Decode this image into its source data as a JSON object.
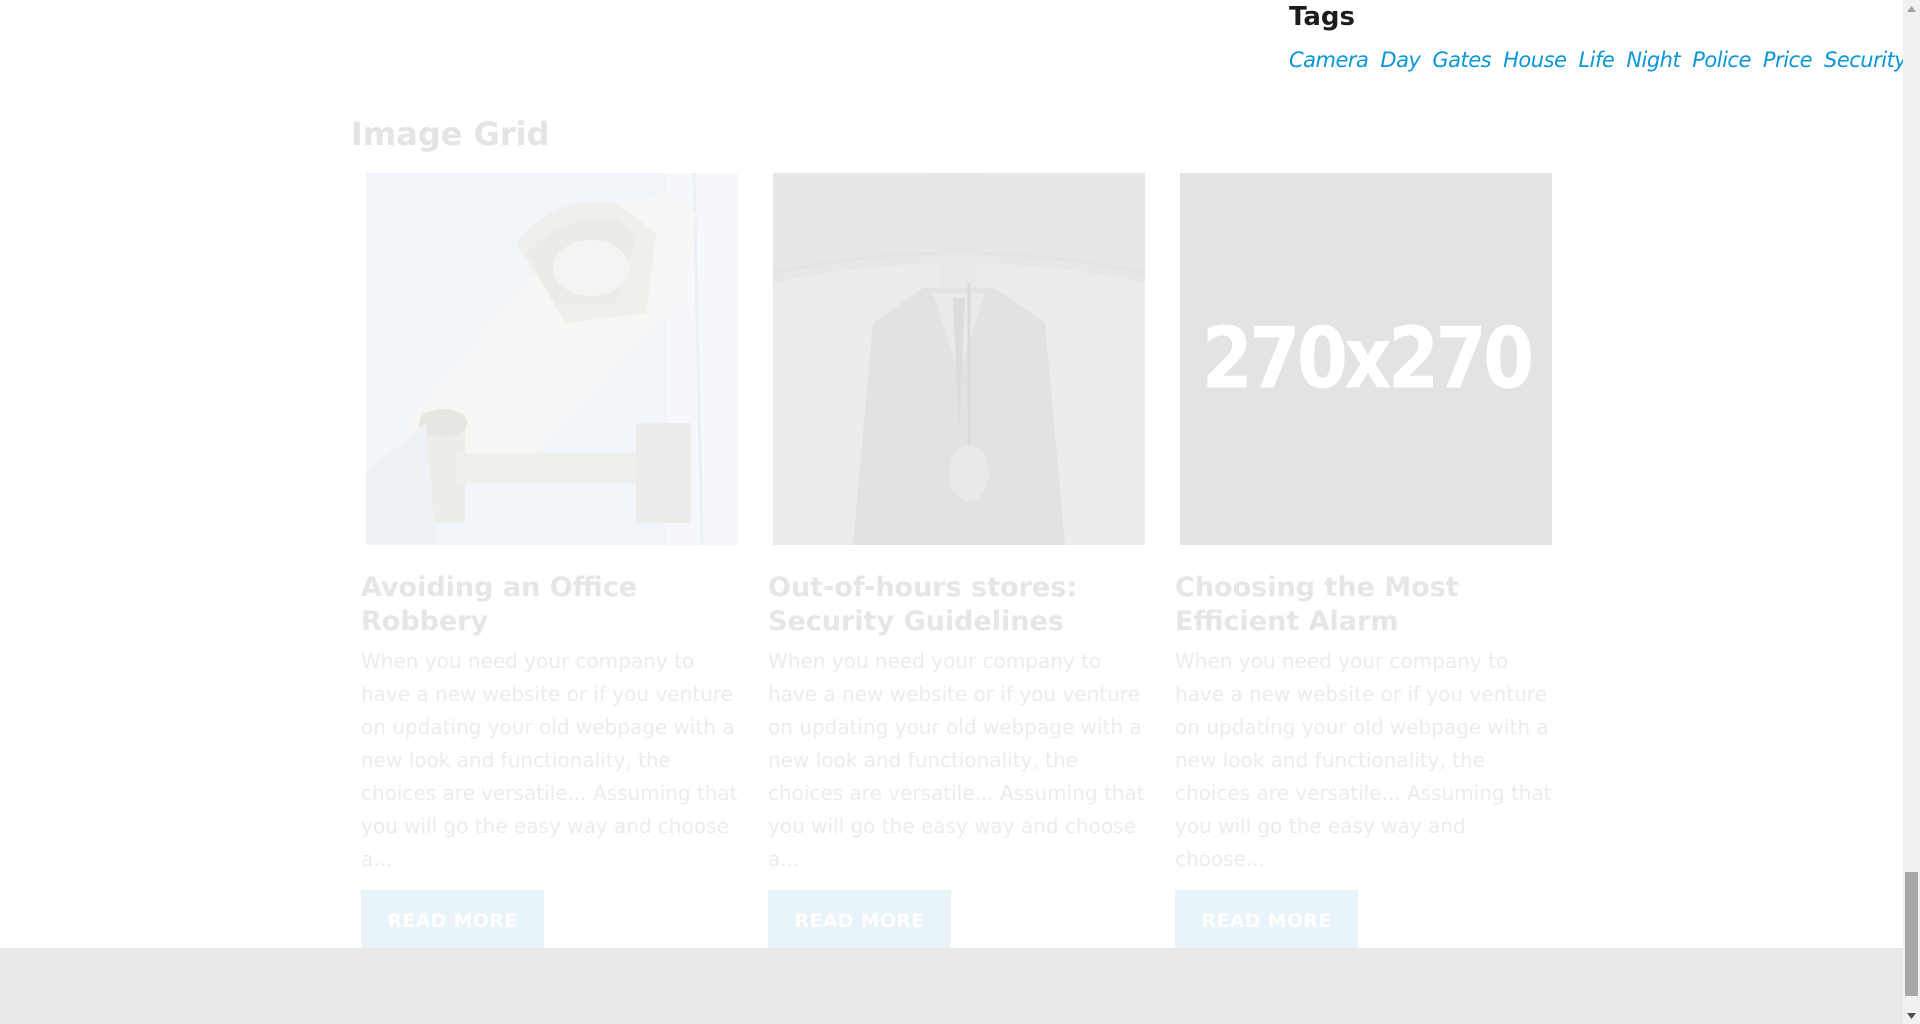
{
  "tags_widget": {
    "title": "Tags",
    "tags": [
      "Camera",
      "Day",
      "Gates",
      "House",
      "Life",
      "Night",
      "Police",
      "Price",
      "Security"
    ]
  },
  "image_grid": {
    "title": "Image Grid",
    "cards": [
      {
        "title": "Avoiding an Office Robbery",
        "text": "When you need your company to have a new website or if you venture on updating your old webpage with a new look and functionality, the choices are versatile... Assuming that you will go the easy way and choose a...",
        "button": "READ MORE"
      },
      {
        "title": "Out-of-hours stores: Security Guidelines",
        "text": "When you need your company to have a new website or if you venture on updating your old webpage with a new look and functionality, the choices are versatile... Assuming that you will go the easy way and choose a...",
        "button": "READ MORE"
      },
      {
        "title": "Choosing the Most Efficient Alarm",
        "text": "  When you need your company to have a new website or if you venture on updating your old webpage with a new look and functionality, the choices are versatile... Assuming that you will go the easy way and choose...",
        "button": "READ MORE",
        "placeholder": "270x270"
      }
    ]
  },
  "colors": {
    "tag_link": "#0b96d6",
    "faded_text": "#e6e6e6",
    "button_bg": "#e8f4fa",
    "footer_bg": "#e9e9ec"
  }
}
